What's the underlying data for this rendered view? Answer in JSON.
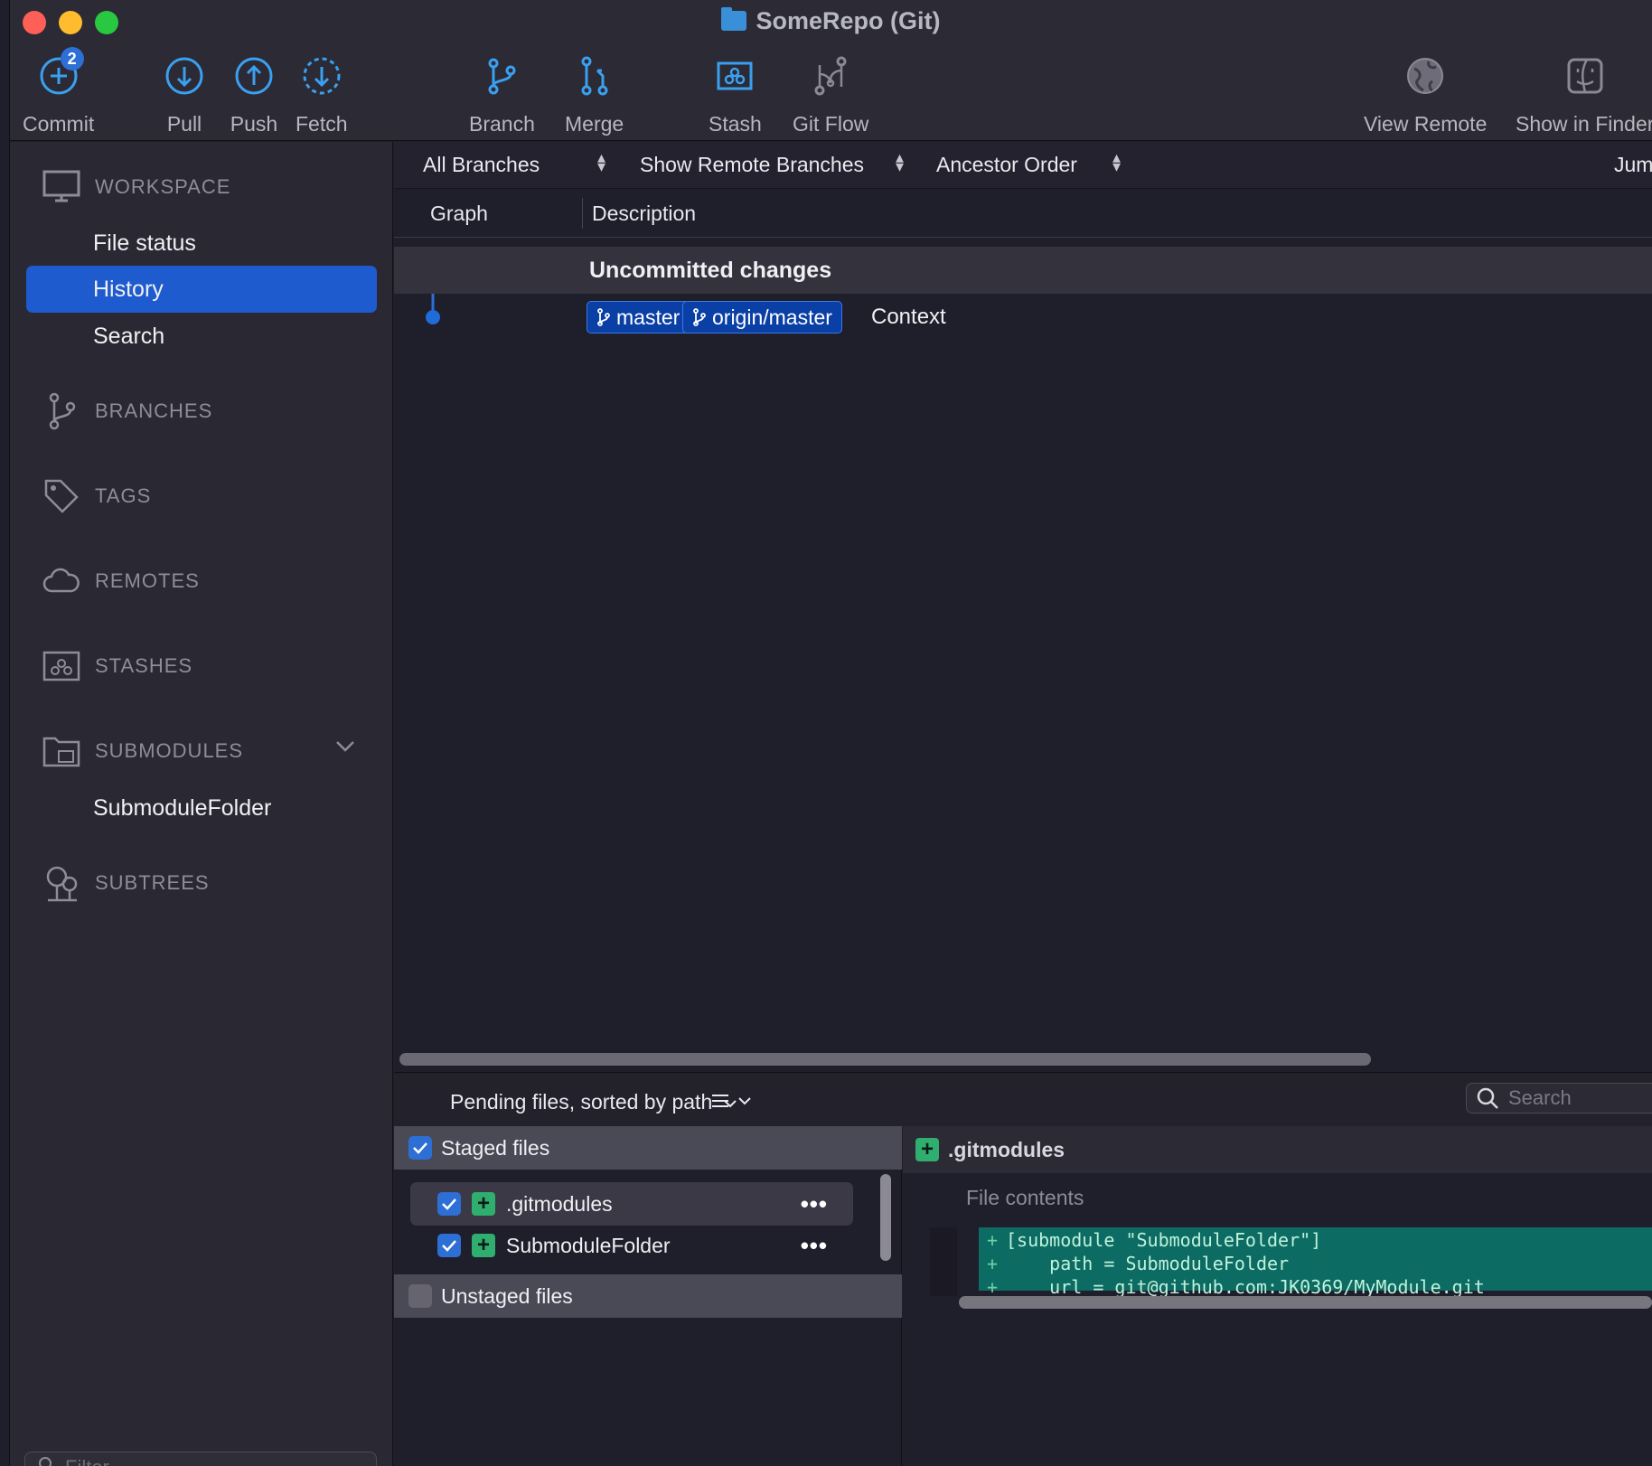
{
  "window": {
    "title": "SomeRepo (Git)"
  },
  "toolbar": {
    "commit": {
      "label": "Commit",
      "badge": "2"
    },
    "pull": {
      "label": "Pull"
    },
    "push": {
      "label": "Push"
    },
    "fetch": {
      "label": "Fetch"
    },
    "branch": {
      "label": "Branch"
    },
    "merge": {
      "label": "Merge"
    },
    "stash": {
      "label": "Stash"
    },
    "gitflow": {
      "label": "Git Flow"
    },
    "view_remote": {
      "label": "View Remote"
    },
    "show_in_finder": {
      "label": "Show in Finder"
    }
  },
  "sidebar": {
    "workspace": {
      "label": "WORKSPACE",
      "items": [
        {
          "label": "File status"
        },
        {
          "label": "History"
        },
        {
          "label": "Search"
        }
      ]
    },
    "branches": "BRANCHES",
    "tags": "TAGS",
    "remotes": "REMOTES",
    "stashes": "STASHES",
    "submodules": {
      "label": "SUBMODULES",
      "items": [
        {
          "label": "SubmoduleFolder"
        }
      ]
    },
    "subtrees": "SUBTREES",
    "filter_placeholder": "Filter"
  },
  "history": {
    "filters": {
      "branches": "All Branches",
      "remote": "Show Remote Branches",
      "order": "Ancestor Order",
      "jump": "Jump"
    },
    "columns": {
      "graph": "Graph",
      "description": "Description"
    },
    "uncommitted": "Uncommitted changes",
    "commit": {
      "refs": [
        "master",
        "origin/master"
      ],
      "message": "Context"
    }
  },
  "pending": {
    "label": "Pending files, sorted by path",
    "search_placeholder": "Search",
    "staged_label": "Staged files",
    "unstaged_label": "Unstaged files",
    "staged_files": [
      {
        "name": ".gitmodules"
      },
      {
        "name": "SubmoduleFolder"
      }
    ]
  },
  "diff": {
    "file": ".gitmodules",
    "subtitle": "File contents",
    "lines": [
      "[submodule \"SubmoduleFolder\"]",
      "    path = SubmoduleFolder",
      "    url = git@github.com:JK0369/MyModule.git"
    ]
  }
}
